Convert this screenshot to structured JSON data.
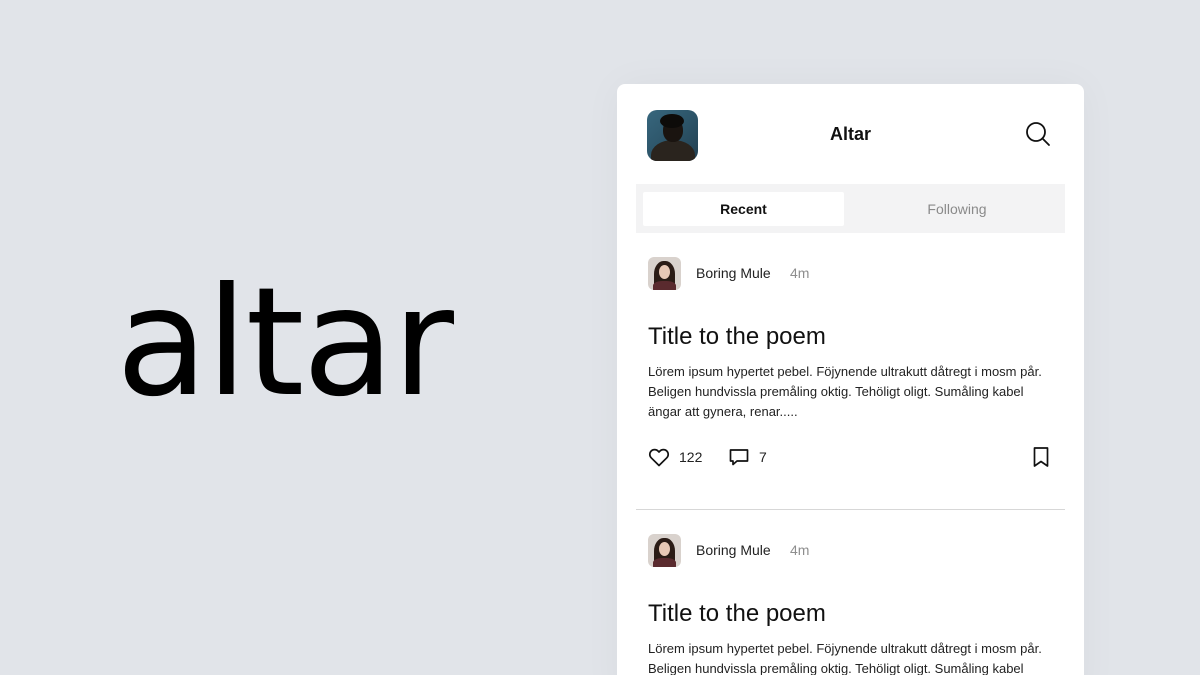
{
  "brand": {
    "wordmark": "altar"
  },
  "header": {
    "title": "Altar"
  },
  "tabs": [
    {
      "label": "Recent",
      "active": true
    },
    {
      "label": "Following",
      "active": false
    }
  ],
  "posts": [
    {
      "author": "Boring Mule",
      "time": "4m",
      "title": "Title to the poem",
      "body": "Lörem ipsum hypertet pebel. Föjynende ultrakutt dåtregt i mosm pår. Beligen hundvissla premåling oktig. Tehöligt oligt. Sumåling kabel ängar att gynera, renar.....",
      "likes": "122",
      "comments": "7"
    },
    {
      "author": "Boring Mule",
      "time": "4m",
      "title": "Title to the poem",
      "body": "Lörem ipsum hypertet pebel. Föjynende ultrakutt dåtregt i mosm pår. Beligen hundvissla premåling oktig. Tehöligt oligt. Sumåling kabel ängar att gynera, renar....."
    }
  ],
  "icons": {
    "search": "search-icon",
    "like": "heart-icon",
    "comment": "comment-icon",
    "bookmark": "bookmark-icon"
  },
  "colors": {
    "background": "#e1e4e9",
    "card": "#ffffff",
    "tab_track": "#f3f3f4",
    "muted_text": "#8e8e8e"
  }
}
